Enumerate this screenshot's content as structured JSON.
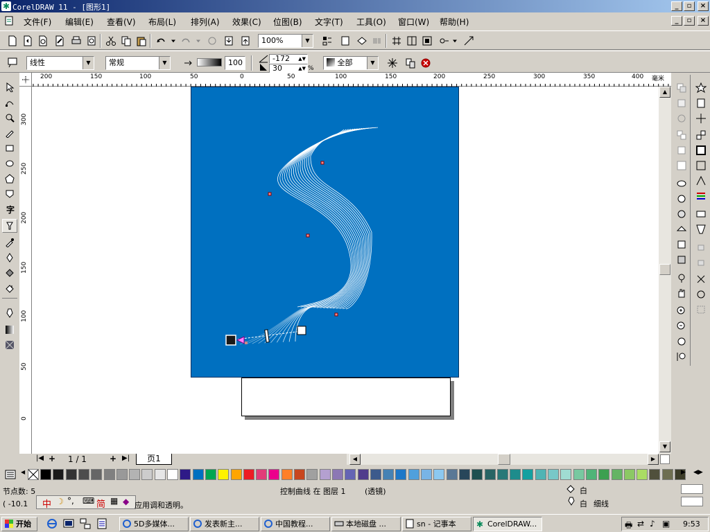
{
  "window": {
    "title": "CorelDRAW 11 - [图形1]",
    "min": "_",
    "max": "□",
    "close": "×"
  },
  "menu": [
    "文件(F)",
    "编辑(E)",
    "查看(V)",
    "布局(L)",
    "排列(A)",
    "效果(C)",
    "位图(B)",
    "文字(T)",
    "工具(O)",
    "窗口(W)",
    "帮助(H)"
  ],
  "toolbar": {
    "zoom": "100%"
  },
  "propertybar": {
    "blend_type": "线性",
    "mode": "常规",
    "midpoint": "100",
    "angle": "-172",
    "edge": "30",
    "percent": "%",
    "target": "全部"
  },
  "ruler": {
    "unit": "毫米",
    "h_labels": [
      "200",
      "150",
      "100",
      "50",
      "0",
      "50",
      "100",
      "150",
      "200",
      "250",
      "300",
      "350",
      "400"
    ],
    "v_labels": [
      "300",
      "250",
      "200",
      "150",
      "100",
      "50",
      "0"
    ]
  },
  "page_nav": {
    "counter": "1 / 1",
    "tab": "页1"
  },
  "status": {
    "nodes": "节点数: 5",
    "object": "控制曲线 在 图层 1",
    "effect": "(透镜)",
    "coords": "( -10.1",
    "hint": "应用调和透明。",
    "fill": "白",
    "outline_color": "白",
    "outline_width": "细线"
  },
  "ime": {
    "mode": "中",
    "punct": "°,",
    "simp": "简"
  },
  "taskbar": {
    "start": "开始",
    "tasks": [
      "5D多媒体...",
      "发表新主...",
      "中国教程...",
      "本地磁盘 ...",
      "sn - 记事本",
      "CorelDRAW..."
    ],
    "clock": "9:53"
  },
  "colors": {
    "page_fill": "#0070c0",
    "palette": [
      "#000000",
      "#1a1a1a",
      "#333333",
      "#4d4d4d",
      "#666666",
      "#808080",
      "#999999",
      "#b3b3b3",
      "#cccccc",
      "#e6e6e6",
      "#ffffff",
      "#2e1a87",
      "#0070c0",
      "#00a651",
      "#fff200",
      "#ffa500",
      "#ed1c24",
      "#e23c78",
      "#ec008c",
      "#ff7f27",
      "#c8461e",
      "#a0a0a0",
      "#b4a0d0",
      "#8c78b4",
      "#6464b4",
      "#503c8c",
      "#3c5a8c",
      "#4682b4",
      "#1e78c8",
      "#50a0dc",
      "#78b4e6",
      "#8cc8f0",
      "#5a7896",
      "#28465a",
      "#1e5050",
      "#286464",
      "#287878",
      "#1e8c8c",
      "#14a0a0",
      "#50b4b4",
      "#78c8c8",
      "#a0dcd2",
      "#78c8a0",
      "#50b478",
      "#3ca050",
      "#64b464",
      "#8cc864",
      "#aadc64",
      "#50503c",
      "#6e6e50",
      "#3c3c28"
    ]
  }
}
